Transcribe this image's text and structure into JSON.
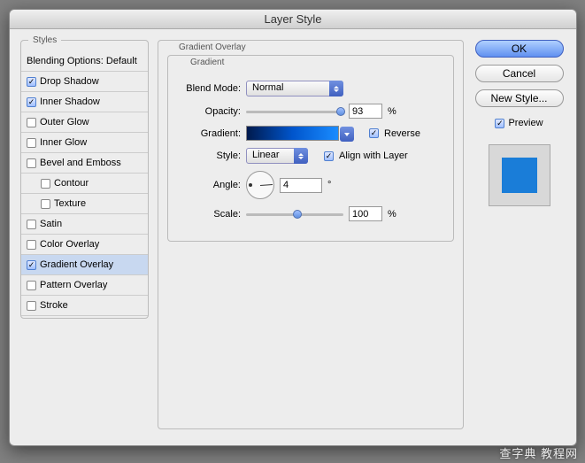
{
  "window": {
    "title": "Layer Style"
  },
  "sidebar": {
    "title": "Styles",
    "header": "Blending Options: Default",
    "items": [
      {
        "label": "Drop Shadow",
        "checked": true,
        "indent": false
      },
      {
        "label": "Inner Shadow",
        "checked": true,
        "indent": false
      },
      {
        "label": "Outer Glow",
        "checked": false,
        "indent": false
      },
      {
        "label": "Inner Glow",
        "checked": false,
        "indent": false
      },
      {
        "label": "Bevel and Emboss",
        "checked": false,
        "indent": false
      },
      {
        "label": "Contour",
        "checked": false,
        "indent": true
      },
      {
        "label": "Texture",
        "checked": false,
        "indent": true
      },
      {
        "label": "Satin",
        "checked": false,
        "indent": false
      },
      {
        "label": "Color Overlay",
        "checked": false,
        "indent": false
      },
      {
        "label": "Gradient Overlay",
        "checked": true,
        "indent": false,
        "selected": true
      },
      {
        "label": "Pattern Overlay",
        "checked": false,
        "indent": false
      },
      {
        "label": "Stroke",
        "checked": false,
        "indent": false
      }
    ]
  },
  "main": {
    "group_title": "Gradient Overlay",
    "inner_title": "Gradient",
    "blend_mode": {
      "label": "Blend Mode:",
      "value": "Normal"
    },
    "opacity": {
      "label": "Opacity:",
      "value": "93",
      "unit": "%"
    },
    "gradient": {
      "label": "Gradient:",
      "reverse_label": "Reverse",
      "reverse_checked": true
    },
    "style": {
      "label": "Style:",
      "value": "Linear",
      "align_label": "Align with Layer",
      "align_checked": true
    },
    "angle": {
      "label": "Angle:",
      "value": "4",
      "unit": "°"
    },
    "scale": {
      "label": "Scale:",
      "value": "100",
      "unit": "%"
    }
  },
  "buttons": {
    "ok": "OK",
    "cancel": "Cancel",
    "new_style": "New Style...",
    "preview_label": "Preview",
    "preview_checked": true,
    "preview_color": "#1a7dd8"
  },
  "watermark": "查字典 教程网"
}
